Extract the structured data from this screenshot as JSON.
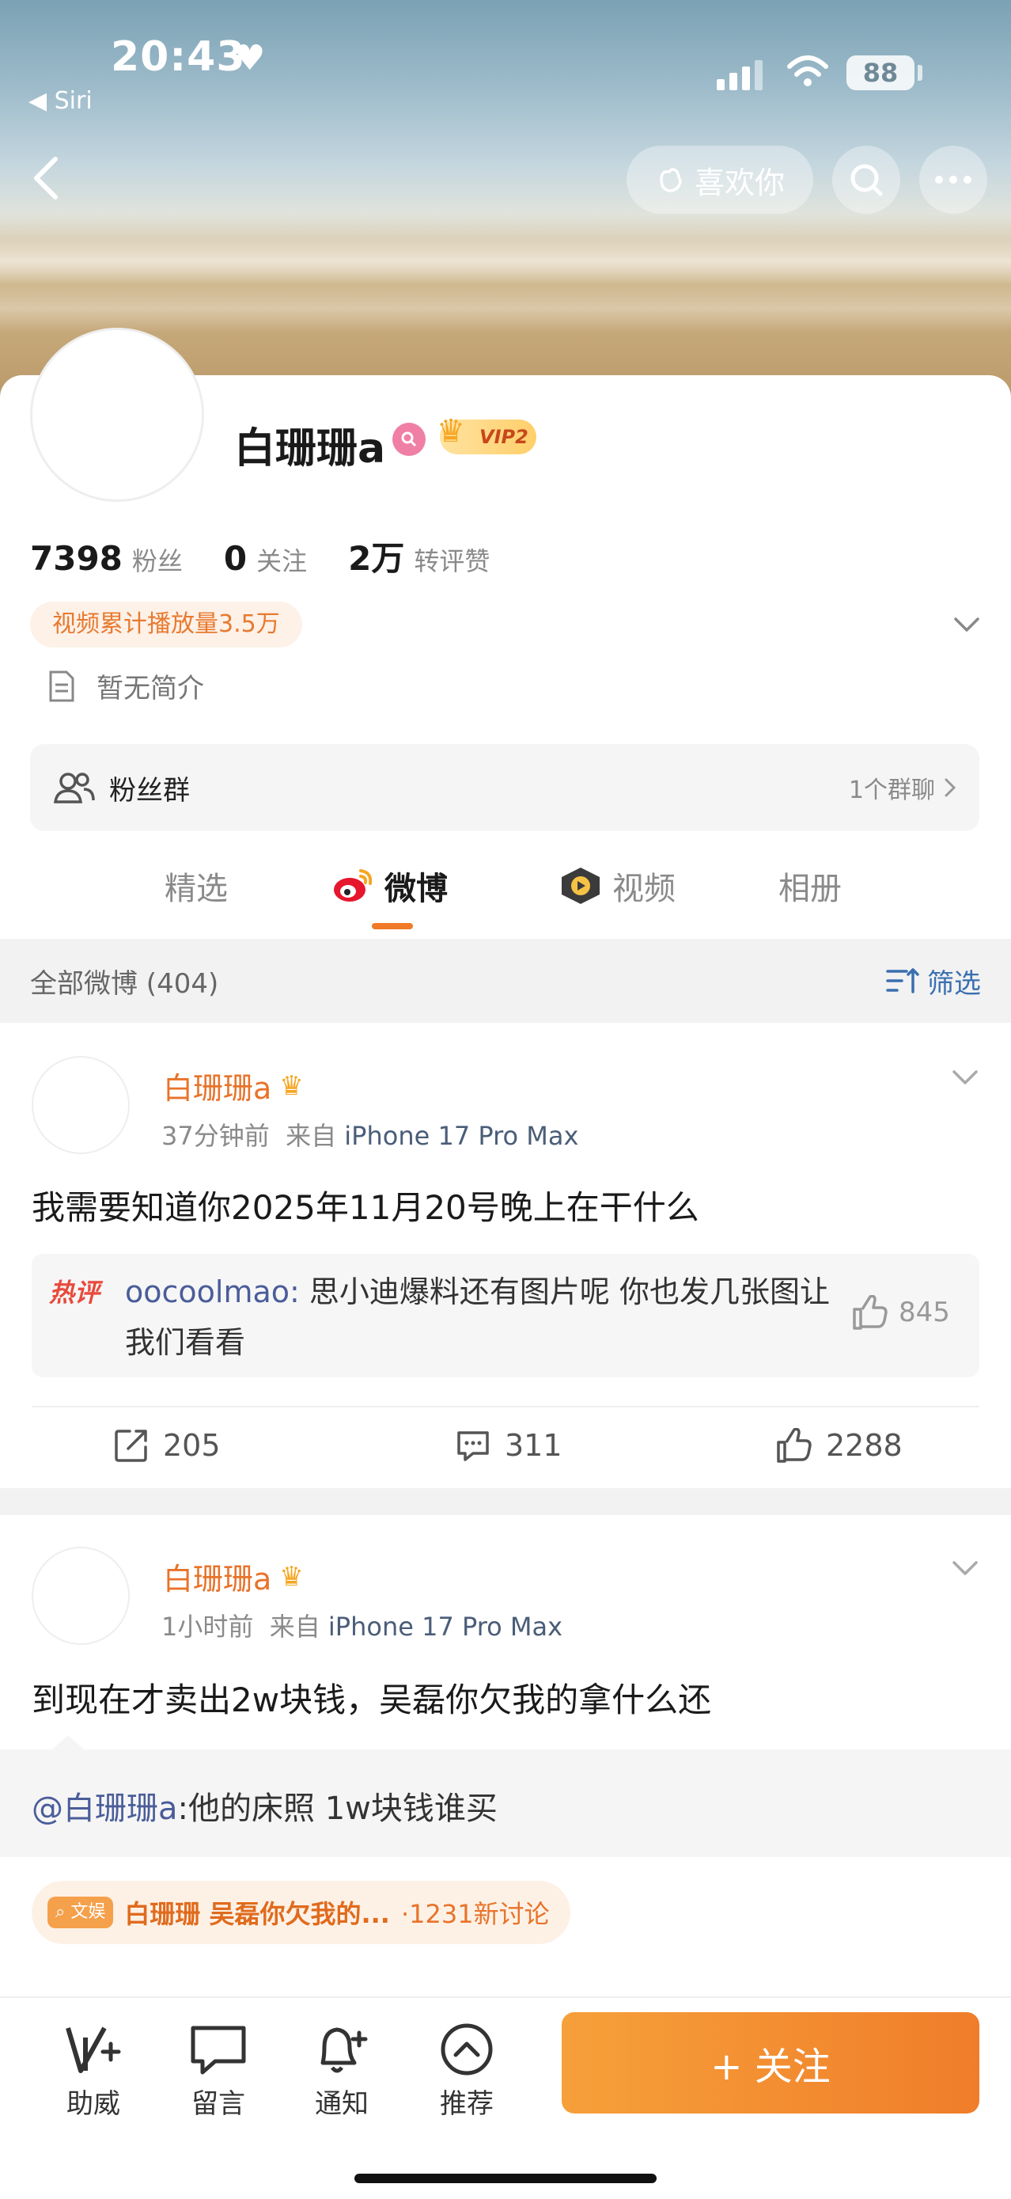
{
  "status_bar": {
    "time": "20:43",
    "back_app": "◀ Siri",
    "battery": "88"
  },
  "header": {
    "like_button": "喜欢你"
  },
  "profile": {
    "name": "白珊珊a",
    "vip": "VIP2",
    "stats": [
      {
        "value": "7398",
        "label": "粉丝"
      },
      {
        "value": "0",
        "label": "关注"
      },
      {
        "value": "2万",
        "label": "转评赞"
      }
    ],
    "play_count": "视频累计播放量3.5万",
    "bio": "暂无简介",
    "fan_group": {
      "label": "粉丝群",
      "right": "1个群聊"
    }
  },
  "tabs": [
    {
      "label": "精选"
    },
    {
      "label": "微博"
    },
    {
      "label": "视频"
    },
    {
      "label": "相册"
    }
  ],
  "filter": {
    "count": "全部微博 (404)",
    "label": "筛选"
  },
  "posts": [
    {
      "author": "白珊珊a",
      "time": "37分钟前",
      "from": "来自",
      "device": "iPhone 17 Pro Max",
      "text": "我需要知道你2025年11月20号晚上在干什么",
      "hot_comment": {
        "tag": "热评",
        "user": "oocoolmao",
        "text": "思小迪爆料还有图片呢 你也发几张图让我们看看",
        "likes": "845"
      },
      "actions": {
        "repost": "205",
        "comment": "311",
        "like": "2288"
      }
    },
    {
      "author": "白珊珊a",
      "time": "1小时前",
      "from": "来自",
      "device": "iPhone 17 Pro Max",
      "text": "到现在才卖出2w块钱，吴磊你欠我的拿什么还",
      "retweet": {
        "at": "@白珊珊a",
        "text": ":他的床照 1w块钱谁买"
      },
      "topic": {
        "tag": "文娱",
        "title": "白珊珊 吴磊你欠我的...",
        "count": "·1231新讨论"
      }
    }
  ],
  "bottom_bar": {
    "items": [
      {
        "label": "助威"
      },
      {
        "label": "留言"
      },
      {
        "label": "通知"
      },
      {
        "label": "推荐"
      }
    ],
    "follow": "+ 关注"
  }
}
